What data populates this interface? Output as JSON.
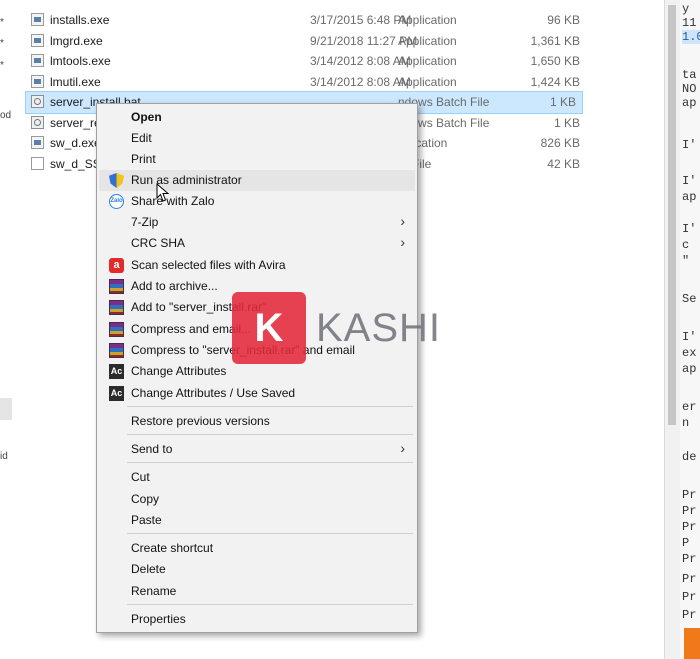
{
  "files": [
    {
      "name": "installs.exe",
      "date": "3/17/2015 6:48 PM",
      "type": "Application",
      "size": "96 KB",
      "icon": "exe-icon"
    },
    {
      "name": "lmgrd.exe",
      "date": "9/21/2018 11:27 PM",
      "type": "Application",
      "size": "1,361 KB",
      "icon": "exe-icon"
    },
    {
      "name": "lmtools.exe",
      "date": "3/14/2012 8:08 AM",
      "type": "Application",
      "size": "1,650 KB",
      "icon": "exe-icon"
    },
    {
      "name": "lmutil.exe",
      "date": "3/14/2012 8:08 AM",
      "type": "Application",
      "size": "1,424 KB",
      "icon": "exe-icon"
    },
    {
      "name": "server_install.bat",
      "date": "",
      "type": "Windows Batch File",
      "size": "1 KB",
      "icon": "batch-file-icon"
    },
    {
      "name": "server_re",
      "date": "",
      "type": "Windows Batch File",
      "size": "1 KB",
      "icon": "batch-file-icon"
    },
    {
      "name": "sw_d.exe",
      "date": "",
      "type": "Application",
      "size": "826 KB",
      "icon": "exe-icon"
    },
    {
      "name": "sw_d_SSQ",
      "date": "",
      "type": "File",
      "size": "42 KB",
      "icon": "document-icon"
    }
  ],
  "visible_type_fragments": {
    "row5": "ndows Batch File",
    "row6": "ndows Batch File",
    "row7": "lication",
    "row8": "File"
  },
  "context_menu": {
    "open": "Open",
    "edit": "Edit",
    "print": "Print",
    "run_as_admin": "Run as administrator",
    "share_zalo": "Share with Zalo",
    "seven_zip": "7-Zip",
    "crc_sha": "CRC SHA",
    "scan_avira": "Scan selected files with Avira",
    "add_archive": "Add to archive...",
    "add_to_rar": "Add to \"server_install.rar\"",
    "compress_email": "Compress and email...",
    "compress_to_rar_email": "Compress to \"server_install.rar\" and email",
    "change_attributes": "Change Attributes",
    "change_attributes_saved": "Change Attributes / Use Saved",
    "restore_versions": "Restore previous versions",
    "send_to": "Send to",
    "cut": "Cut",
    "copy": "Copy",
    "paste": "Paste",
    "create_shortcut": "Create shortcut",
    "delete": "Delete",
    "rename": "Rename",
    "properties": "Properties",
    "submenu_arrow": "›"
  },
  "icons": {
    "run_as_admin": "uac-shield-icon",
    "share_zalo": "zalo-icon",
    "scan_avira": "avira-icon",
    "rar": "winrar-icon",
    "attributes": "attribute-changer-icon"
  },
  "watermark": {
    "letter": "K",
    "text": "KASHI"
  },
  "code_pane_lines": [
    "y",
    "11",
    "ta",
    "NO",
    "ap",
    "I'",
    "I'",
    "ap",
    "I'",
    "c",
    "\"",
    "Se",
    "I'",
    "ex",
    "ap",
    "er",
    "n",
    "de",
    "Pr",
    "Pr",
    "Pr",
    "P",
    "Pr",
    "Pr",
    "Pr",
    "Pr"
  ],
  "code_highlight": "1.0",
  "left_strip_glyphs": [
    "*",
    "*",
    "*",
    "od",
    "id"
  ],
  "colors": {
    "selection": "#cce8ff",
    "menu_bg": "#f2f2f2",
    "hover": "#e5e5e5",
    "watermark": "#e2283a",
    "accent_bar": "#f07a1a"
  }
}
